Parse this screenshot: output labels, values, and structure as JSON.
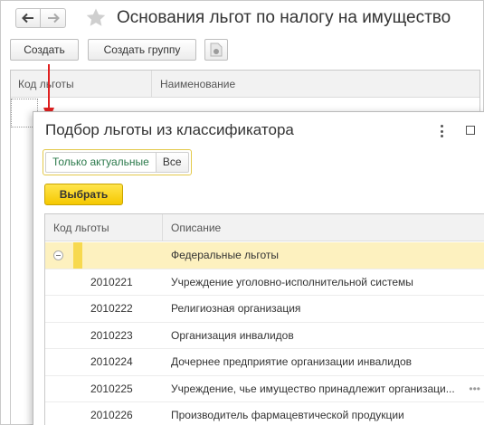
{
  "outer": {
    "title": "Основания льгот по налогу на имущество",
    "toolbar": {
      "create_label": "Создать",
      "create_group_label": "Создать группу"
    },
    "columns": {
      "code": "Код льготы",
      "name": "Наименование"
    }
  },
  "dialog": {
    "title": "Подбор льготы из классификатора",
    "filter": {
      "active": "Только актуальные",
      "all": "Все"
    },
    "select_label": "Выбрать",
    "columns": {
      "code": "Код льготы",
      "description": "Описание"
    },
    "group": {
      "label": "Федеральные льготы"
    },
    "rows": [
      {
        "code": "2010221",
        "description": "Учреждение уголовно-исполнительной системы"
      },
      {
        "code": "2010222",
        "description": "Религиозная организация"
      },
      {
        "code": "2010223",
        "description": "Организация инвалидов"
      },
      {
        "code": "2010224",
        "description": "Дочернее предприятие организации инвалидов"
      },
      {
        "code": "2010225",
        "description": "Учреждение, чье имущество принадлежит организаци..."
      },
      {
        "code": "2010226",
        "description": "Производитель фармацевтической продукции"
      }
    ]
  },
  "icons": [
    "back-arrow-icon",
    "forward-arrow-icon",
    "favorite-star-icon",
    "document-icon",
    "more-menu-icon",
    "maximize-icon",
    "collapse-icon"
  ],
  "colors": {
    "accent_yellow": "#f5c800",
    "group_highlight": "#fdf1bf",
    "active_filter_text": "#2b7a4b",
    "arrow_red": "#e02020"
  }
}
